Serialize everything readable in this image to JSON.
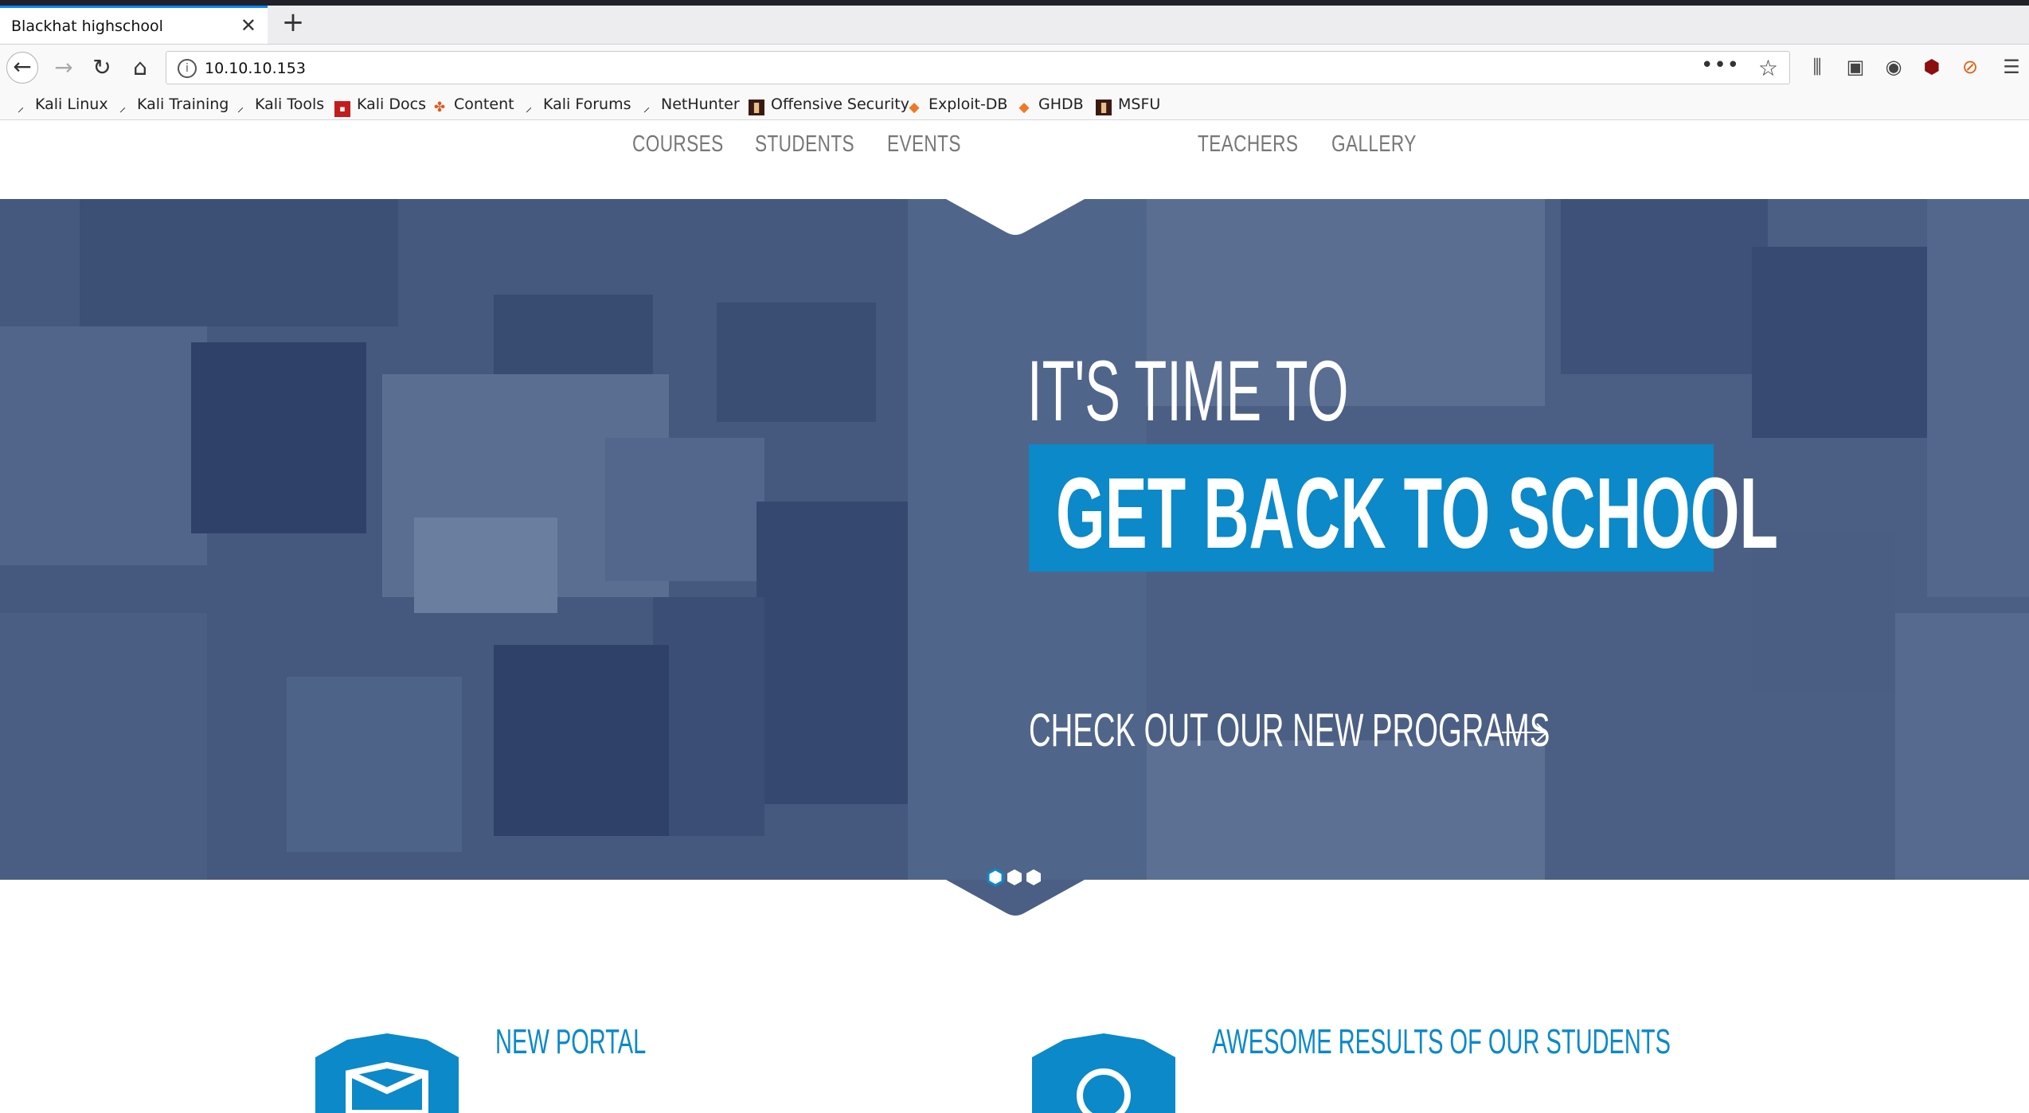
{
  "browser": {
    "tab": {
      "title": "Blackhat highschool"
    },
    "url": "10.10.10.153",
    "bookmarks": [
      {
        "label": "Kali Linux"
      },
      {
        "label": "Kali Training"
      },
      {
        "label": "Kali Tools"
      },
      {
        "label": "Kali Docs"
      },
      {
        "label": "Content"
      },
      {
        "label": "Kali Forums"
      },
      {
        "label": "NetHunter"
      },
      {
        "label": "Offensive Security"
      },
      {
        "label": "Exploit-DB"
      },
      {
        "label": "GHDB"
      },
      {
        "label": "MSFU"
      }
    ]
  },
  "site": {
    "nav": [
      "COURSES",
      "STUDENTS",
      "EVENTS",
      "TEACHERS",
      "GALLERY"
    ],
    "hero": {
      "line1": "IT'S TIME TO",
      "line2": "GET BACK TO SCHOOL",
      "cta": "CHECK OUT OUR NEW PROGRAMS",
      "slides": 3,
      "active_slide": 1
    },
    "features": [
      {
        "title": "NEW PORTAL"
      },
      {
        "title": "AWESOME RESULTS OF OUR STUDENTS"
      }
    ]
  },
  "colors": {
    "accent": "#0b89c9",
    "hero_bg": "#4b5f84",
    "nav_text": "#777777"
  }
}
